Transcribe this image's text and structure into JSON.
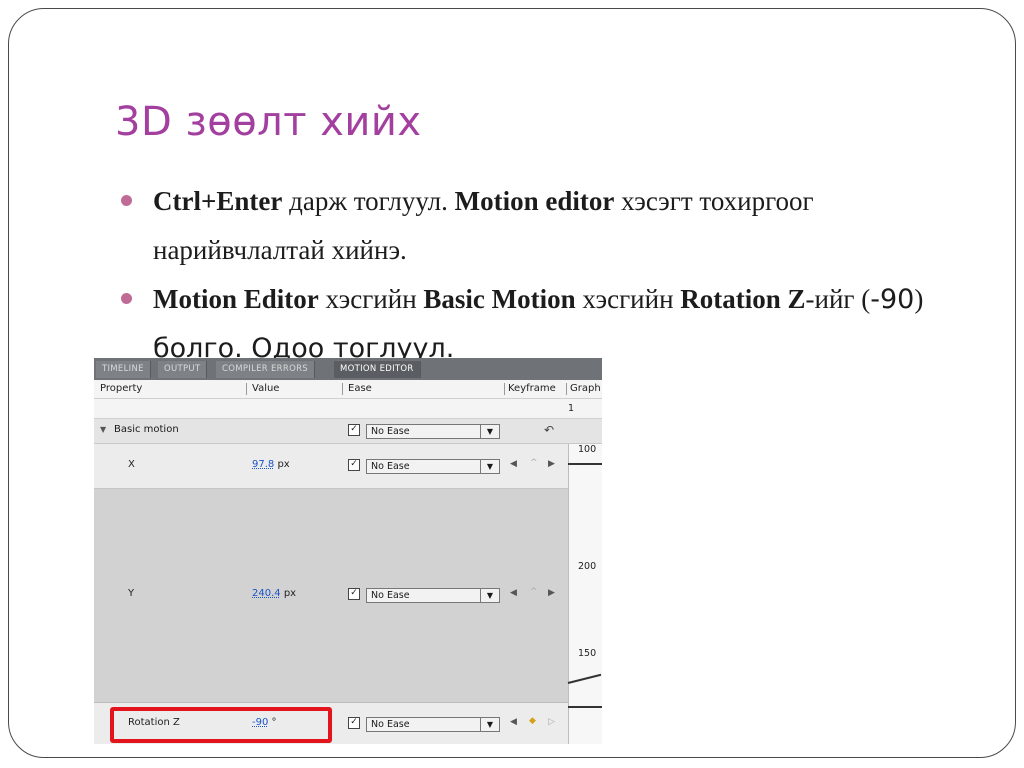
{
  "slide": {
    "title": "3D зөөлт хийх",
    "bullet1": {
      "b1": "Ctrl+Enter",
      "t1": " дарж тоглуул. ",
      "b2": "Motion editor",
      "t2": " хэсэгт тохиргоог нарийвчлалтай хийнэ."
    },
    "bullet2": {
      "b1": "Motion Editor",
      "t1": " хэсгийн ",
      "b2": "Basic Motion",
      "t2": " хэсгийн ",
      "b3": "Rotation Z",
      "t3": "-ийг ",
      "t4": "(",
      "t5": "-90",
      "t6": ")",
      "t7": " болго. Одоо тоглуул."
    }
  },
  "editor": {
    "tabs": [
      "TIMELINE",
      "OUTPUT",
      "COMPILER ERRORS",
      "MOTION EDITOR"
    ],
    "active_tab": "MOTION EDITOR",
    "columns": {
      "property": "Property",
      "value": "Value",
      "ease": "Ease",
      "keyframe": "Keyframe",
      "graph": "Graph"
    },
    "frame_number": "1",
    "group": {
      "label": "Basic motion",
      "ease": "No Ease"
    },
    "rows": [
      {
        "name": "X",
        "value": "97.8",
        "unit": "px",
        "ease": "No Ease"
      },
      {
        "name": "Y",
        "value": "240.4",
        "unit": "px",
        "ease": "No Ease"
      },
      {
        "name": "Rotation Z",
        "value": "-90",
        "unit": "°",
        "ease": "No Ease"
      }
    ],
    "graph_labels": [
      "100",
      "200",
      "150"
    ],
    "icons": {
      "collapse": "triangle-down-icon",
      "reset": "reset-icon",
      "prev_key": "prev-keyframe-icon",
      "add_key": "add-keyframe-icon",
      "next_key": "next-keyframe-icon"
    }
  },
  "colors": {
    "title": "#a33f9f",
    "bullet": "#c06a96",
    "highlight": "#e3141c",
    "link": "#1a53c8"
  }
}
